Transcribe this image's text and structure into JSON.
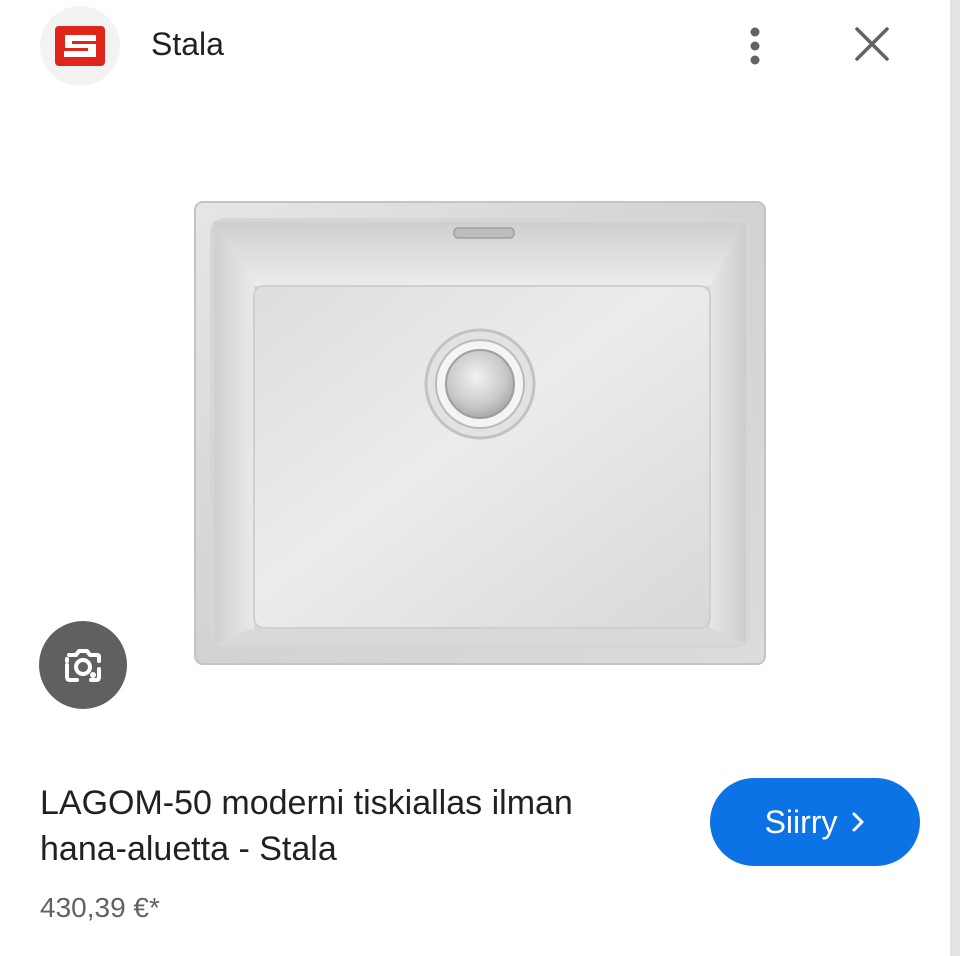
{
  "header": {
    "logo_icon": "stala-logo-icon",
    "site_name": "Stala",
    "more_icon": "more-vertical-icon",
    "close_icon": "close-icon"
  },
  "image": {
    "subject": "stainless-steel-sink",
    "lens_icon": "google-lens-icon"
  },
  "product": {
    "title": "LAGOM-50 moderni tiskiallas ilman hana-aluetta - Stala",
    "price": "430,39 €*"
  },
  "action": {
    "visit_label": "Siirry",
    "visit_icon": "chevron-right-icon"
  },
  "colors": {
    "brand_red": "#e0261b",
    "accent_blue": "#0b73e6",
    "lens_bg": "#5f6062"
  }
}
